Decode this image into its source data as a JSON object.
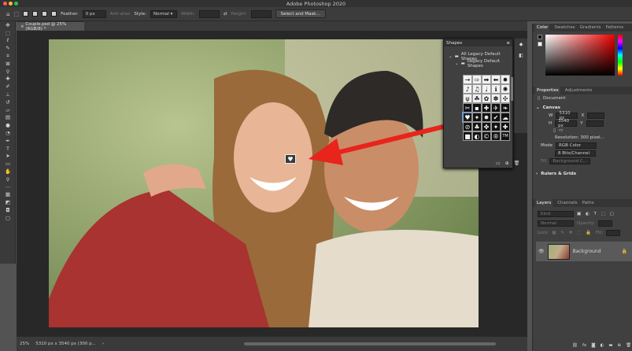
{
  "window": {
    "title": "Adobe Photoshop 2020"
  },
  "options": {
    "feather_label": "Feather:",
    "feather_value": "0 px",
    "antialias_label": "Anti-alias",
    "style_label": "Style:",
    "style_value": "Normal",
    "width_label": "Width:",
    "height_label": "Height:",
    "select_mask_label": "Select and Mask..."
  },
  "document": {
    "tab_label": "Couple.psd @ 25% (RGB/8) *"
  },
  "status": {
    "zoom": "25%",
    "size": "5310 px x 3540 px (300 p..."
  },
  "shapes_panel": {
    "title": "Shapes",
    "group_all": "All Legacy Default Shapes",
    "group_legacy": "Legacy Default Shapes",
    "shapes": [
      "→",
      "⇨",
      "➡",
      "⬅",
      "✹",
      "♪",
      "♫",
      "♩",
      "ℹ",
      "✺",
      "ψ",
      "☘",
      "✿",
      "✽",
      "✣",
      "✂",
      "▪",
      "✚",
      "✈",
      "❧",
      "♥",
      "✦",
      "✸",
      "✔",
      "☁",
      "⊘",
      "♣",
      "✤",
      "✦",
      "✚",
      "■",
      "◐",
      "©",
      "®",
      "TM"
    ]
  },
  "right_panel": {
    "color_tabs": [
      "Color",
      "Swatches",
      "Gradients",
      "Patterns"
    ],
    "prop_tabs": [
      "Properties",
      "Adjustments"
    ],
    "document_label": "Document",
    "canvas_section": "Canvas",
    "w_label": "W",
    "w_value": "5310 px",
    "x_label": "X",
    "h_label": "H",
    "h_value": "3540 px",
    "y_label": "Y",
    "resolution": "Resolution: 300 pixel...",
    "mode_label": "Mode",
    "mode_value": "RGB Color",
    "bits_value": "8 Bits/Channel",
    "fill_label": "Fill",
    "fill_value": "Background C...",
    "rulers_section": "Rulers & Grids",
    "layer_tabs": [
      "Layers",
      "Channels",
      "Paths"
    ],
    "kind_placeholder": "Kind",
    "blend_value": "Normal",
    "opacity_label": "Opacity:",
    "lock_label": "Lock:",
    "fill2_label": "Fill:",
    "layer_name": "Background"
  },
  "colors": {
    "accent": "#4ea1ff",
    "arrow": "#e8241c"
  }
}
